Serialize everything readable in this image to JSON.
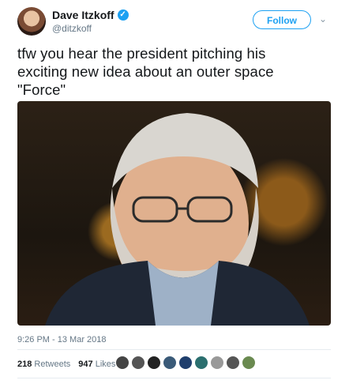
{
  "user": {
    "name": "Dave Itzkoff",
    "handle": "@ditzkoff",
    "avatar_icon": "profile-avatar"
  },
  "follow_label": "Follow",
  "tweet": {
    "text": "tfw you hear the president pitching his exciting new idea about an outer space \"Force\"",
    "timestamp": "9:26 PM - 13 Mar 2018"
  },
  "stats": {
    "retweets_count": "218",
    "retweets_label": "Retweets",
    "likes_count": "947",
    "likes_label": "Likes"
  },
  "colors": {
    "accent": "#1da1f2",
    "muted": "#657786",
    "text": "#14171a"
  }
}
